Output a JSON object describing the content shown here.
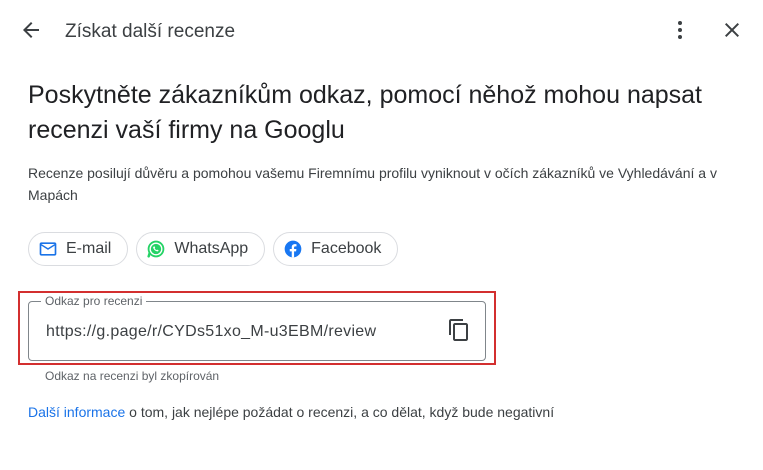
{
  "header": {
    "title": "Získat další recenze",
    "back_icon": "arrow-left-icon",
    "more_icon": "more-vert-icon",
    "close_icon": "close-icon"
  },
  "main": {
    "headline": "Poskytněte zákazníkům odkaz, pomocí něhož mohou napsat recenzi vaší firmy na Googlu",
    "description": "Recenze posilují důvěru a pomohou vašemu Firemnímu profilu vyniknout v očích zákazníků ve Vyhledávání a v Mapách",
    "share_chips": [
      {
        "label": "E-mail",
        "icon": "email-icon"
      },
      {
        "label": "WhatsApp",
        "icon": "whatsapp-icon"
      },
      {
        "label": "Facebook",
        "icon": "facebook-icon"
      }
    ],
    "review_link": {
      "label": "Odkaz pro recenzi",
      "value": "https://g.page/r/CYDs51xo_M-u3EBM/review",
      "copy_icon": "copy-icon",
      "helper": "Odkaz na recenzi byl zkopírován"
    },
    "footer": {
      "link_text": "Další informace",
      "rest_text": " o tom, jak nejlépe požádat o recenzi, a co dělat, když bude negativní"
    }
  },
  "colors": {
    "accent_link": "#1a73e8",
    "highlight_border": "#d32f2f",
    "whatsapp_green": "#25d366",
    "facebook_blue": "#1877f2",
    "email_blue": "#1a73e8"
  }
}
